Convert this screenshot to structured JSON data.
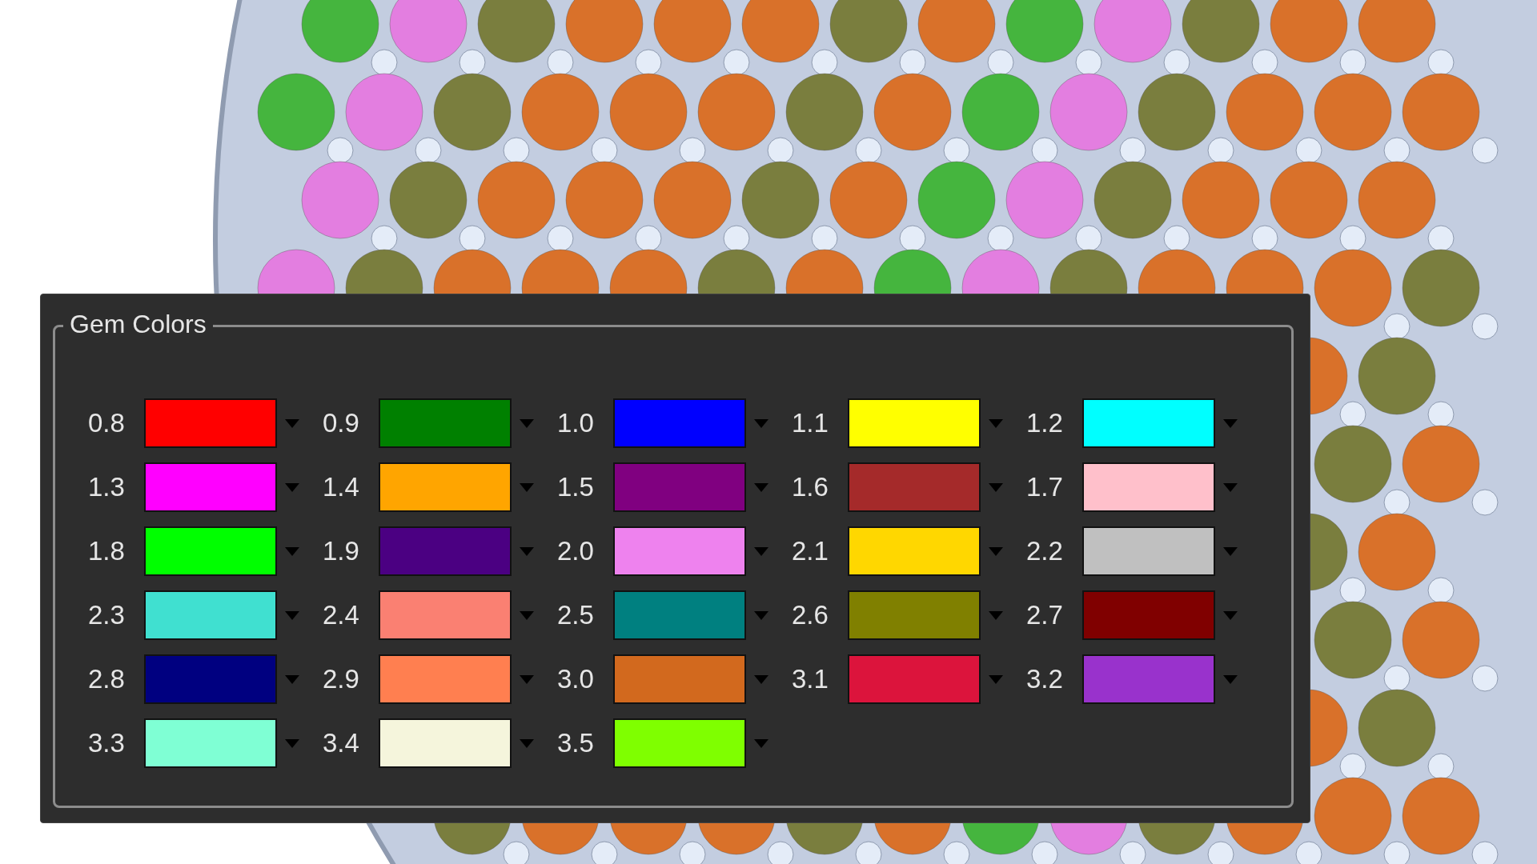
{
  "gem_colors": {
    "title": "Gem Colors",
    "items": [
      {
        "label": "0.8",
        "color": "#ff0000"
      },
      {
        "label": "0.9",
        "color": "#008000"
      },
      {
        "label": "1.0",
        "color": "#0000ff"
      },
      {
        "label": "1.1",
        "color": "#ffff00"
      },
      {
        "label": "1.2",
        "color": "#00ffff"
      },
      {
        "label": "1.3",
        "color": "#ff00ff"
      },
      {
        "label": "1.4",
        "color": "#ffa500"
      },
      {
        "label": "1.5",
        "color": "#800080"
      },
      {
        "label": "1.6",
        "color": "#a52a2a"
      },
      {
        "label": "1.7",
        "color": "#ffc0cb"
      },
      {
        "label": "1.8",
        "color": "#00ff00"
      },
      {
        "label": "1.9",
        "color": "#4b0082"
      },
      {
        "label": "2.0",
        "color": "#ee82ee"
      },
      {
        "label": "2.1",
        "color": "#ffd700"
      },
      {
        "label": "2.2",
        "color": "#c0c0c0"
      },
      {
        "label": "2.3",
        "color": "#40e0d0"
      },
      {
        "label": "2.4",
        "color": "#fa8072"
      },
      {
        "label": "2.5",
        "color": "#008080"
      },
      {
        "label": "2.6",
        "color": "#808000"
      },
      {
        "label": "2.7",
        "color": "#800000"
      },
      {
        "label": "2.8",
        "color": "#000080"
      },
      {
        "label": "2.9",
        "color": "#ff7f50"
      },
      {
        "label": "3.0",
        "color": "#d2691e"
      },
      {
        "label": "3.1",
        "color": "#dc143c"
      },
      {
        "label": "3.2",
        "color": "#9932cc"
      },
      {
        "label": "3.3",
        "color": "#7fffd4"
      },
      {
        "label": "3.4",
        "color": "#f5f5dc"
      },
      {
        "label": "3.5",
        "color": "#7fff00"
      }
    ]
  }
}
